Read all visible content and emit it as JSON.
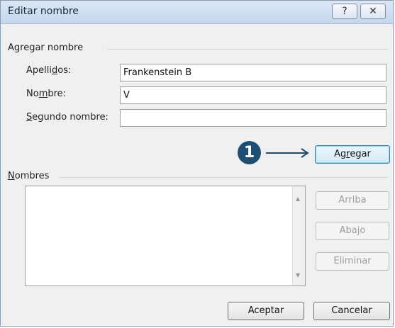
{
  "window": {
    "title": "Editar nombre",
    "help_glyph": "?",
    "close_glyph": "✕"
  },
  "add_section": {
    "title": "Agregar nombre",
    "apellidos_label": {
      "pre": "Apelli",
      "key": "d",
      "post": "os:"
    },
    "nombre_label": {
      "pre": "No",
      "key": "m",
      "post": "bre:"
    },
    "segundo_label": {
      "pre": "",
      "key": "S",
      "post": "egundo nombre:"
    },
    "apellidos_value": "Frankenstein B",
    "nombre_value": "V",
    "segundo_value": "",
    "add_button": {
      "pre": "Ag",
      "key": "r",
      "post": "egar"
    }
  },
  "callout": {
    "number": "1",
    "icon": "arrow-right-icon"
  },
  "names_section": {
    "title": {
      "pre": "",
      "key": "N",
      "post": "ombres"
    },
    "items": [],
    "up_button": "Arriba",
    "down_button": "Abajo",
    "delete_button": "Eliminar"
  },
  "footer": {
    "ok_button": "Aceptar",
    "cancel_button": "Cancelar"
  }
}
